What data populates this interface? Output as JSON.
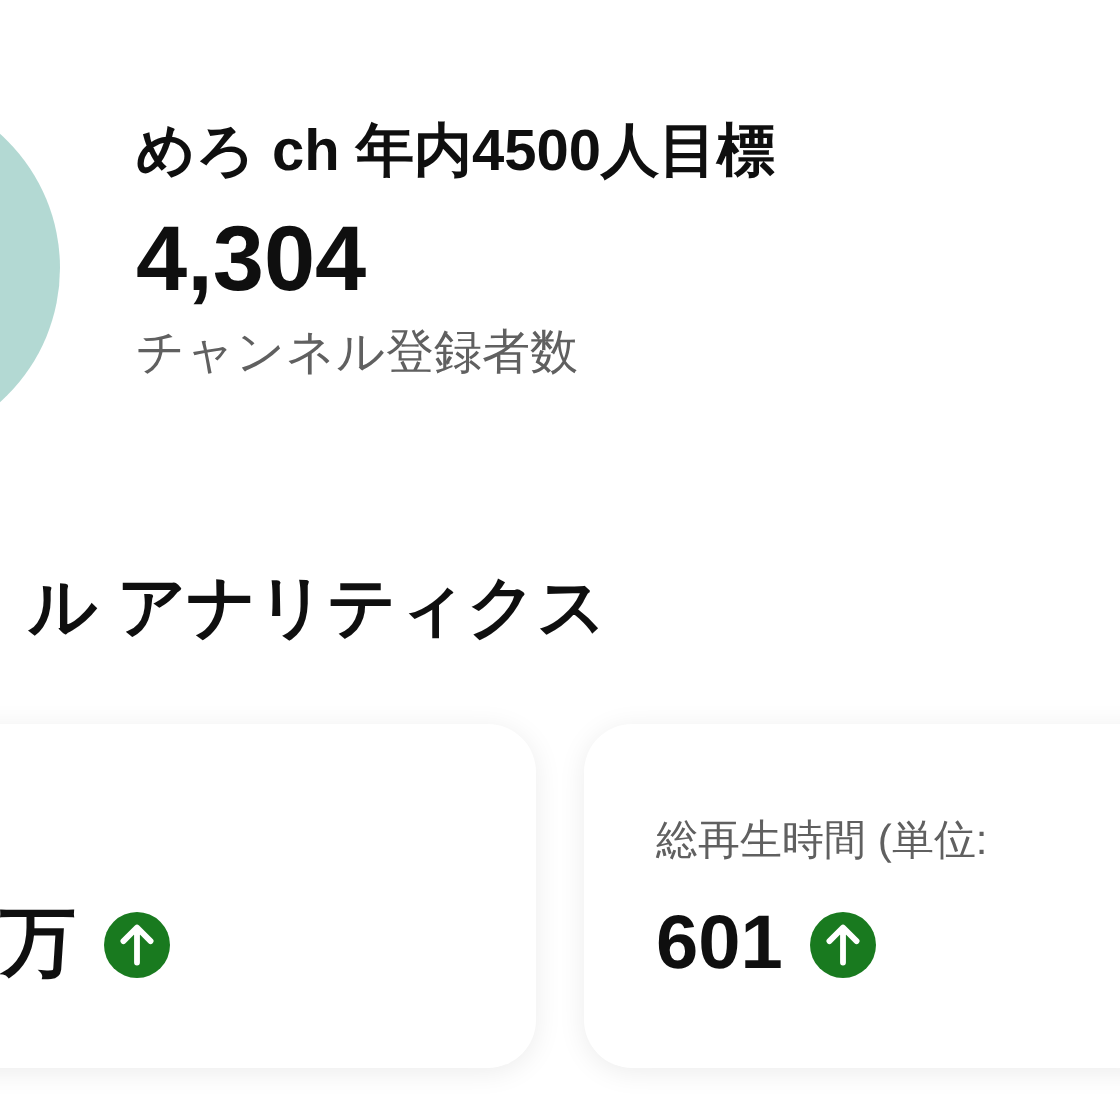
{
  "channel": {
    "title": "めろ ch 年内4500人目標",
    "subscriber_count": "4,304",
    "subscriber_label": "チャンネル登録者数"
  },
  "analytics": {
    "heading": "ル アナリティクス",
    "cards": [
      {
        "value": "万",
        "increased": true
      },
      {
        "label": "総再生時間 (単位:",
        "value": "601",
        "increased": true
      }
    ]
  }
}
